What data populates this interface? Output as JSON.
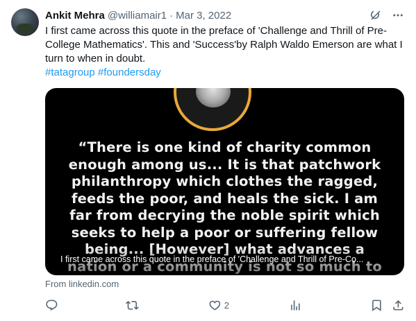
{
  "author": {
    "name": "Ankit Mehra",
    "handle": "@williamair1",
    "separator": "·",
    "date": "Mar 3, 2022"
  },
  "tweet": {
    "text": "I first came across this quote in the preface of 'Challenge and Thrill of Pre-College Mathematics'. This and 'Success'by Ralph Waldo Emerson are what I turn to when in doubt.",
    "hashtags": [
      "#tatagroup",
      "#foundersday"
    ]
  },
  "card": {
    "quote": "“There is one kind of charity common enough among us... It is that patchwork philanthropy which clothes the ragged, feeds the poor, and heals the sick. I am far from decrying the noble spirit which seeks to help a poor or suffering fellow being... [However] what advances a nation or a community is not so much to prop up its weakest and most helpless members, but to lift up",
    "caption": "I first came across this quote in the preface of 'Challenge and Thrill of Pre-Co...",
    "source": "From linkedin.com",
    "accent_color": "#e8a93a"
  },
  "actions": {
    "reply_count": "",
    "repost_count": "",
    "like_count": "2",
    "views_count": ""
  },
  "icons": {
    "header": [
      "grok-icon",
      "more-icon"
    ],
    "actions": [
      "reply-icon",
      "repost-icon",
      "like-icon",
      "views-icon",
      "bookmark-icon",
      "share-icon"
    ]
  },
  "colors": {
    "link": "#1d9bf0",
    "secondary_text": "#536471",
    "primary_text": "#0f1419"
  }
}
